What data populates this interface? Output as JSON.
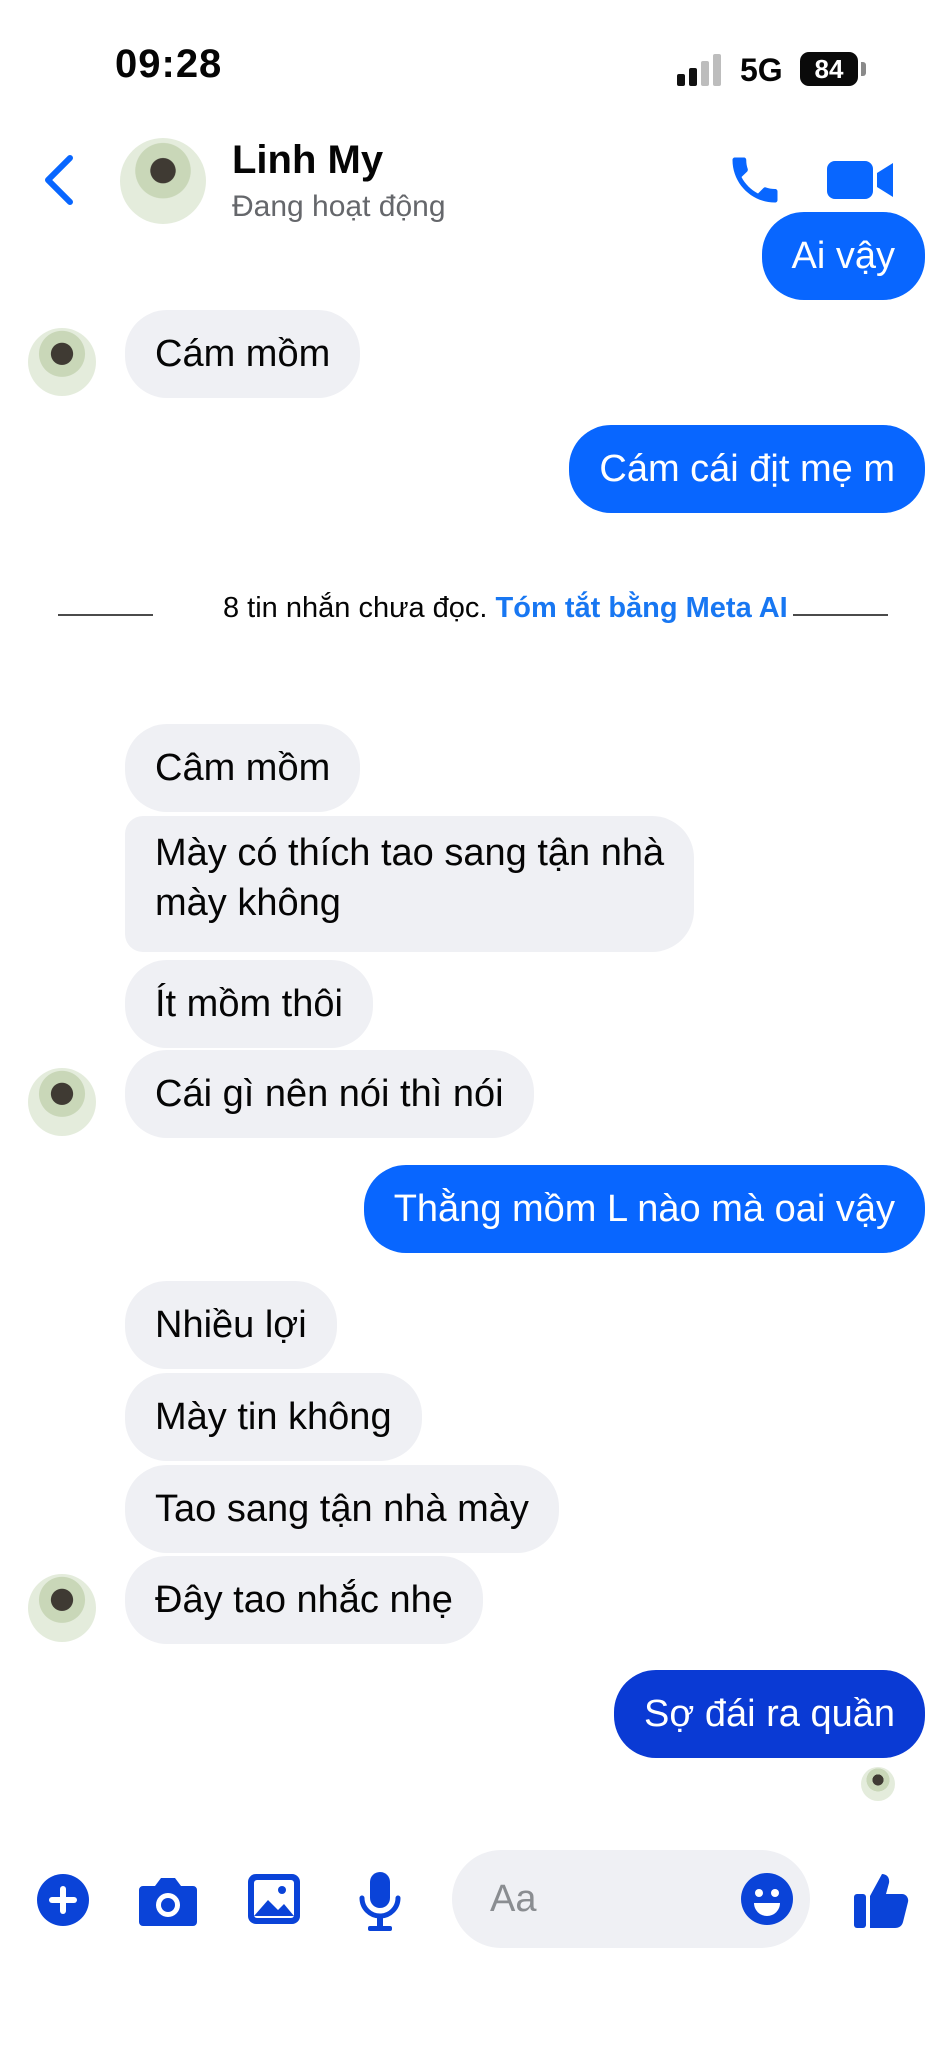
{
  "status_bar": {
    "time": "09:28",
    "network": "5G",
    "battery": "84"
  },
  "header": {
    "name": "Linh My",
    "status": "Đang hoạt động"
  },
  "messages": [
    {
      "dir": "out",
      "text": "Ai vậy"
    },
    {
      "dir": "in",
      "text": "Cám mồm"
    },
    {
      "dir": "out",
      "text": "Cám cái địt mẹ m"
    },
    {
      "dir": "in",
      "text": "Câm mồm"
    },
    {
      "dir": "in",
      "text": "Mày có thích tao sang tận nhà"
    },
    {
      "dir": "in",
      "text": "mày không"
    },
    {
      "dir": "in",
      "text": "Ít mồm thôi"
    },
    {
      "dir": "in",
      "text": "Cái gì nên nói thì nói"
    },
    {
      "dir": "out",
      "text": "Thằng mồm L nào mà oai vậy"
    },
    {
      "dir": "in",
      "text": "Nhiều lợi"
    },
    {
      "dir": "in",
      "text": "Mày tin không"
    },
    {
      "dir": "in",
      "text": "Tao sang tận nhà mày"
    },
    {
      "dir": "in",
      "text": "Đây tao nhắc nhẹ"
    },
    {
      "dir": "out",
      "text": "Sợ đái ra quần"
    }
  ],
  "divider": {
    "text": "8 tin nhắn chưa đọc.",
    "link": "Tóm tắt bằng Meta AI"
  },
  "composer": {
    "placeholder": "Aa"
  },
  "icons": {
    "back": "chevron-left-icon",
    "call": "phone-icon",
    "video": "video-camera-icon",
    "add": "plus-icon",
    "camera": "camera-icon",
    "gallery": "image-icon",
    "mic": "microphone-icon",
    "emoji": "smiley-icon",
    "like": "thumbs-up-icon"
  },
  "colors": {
    "accent": "#0866ff",
    "icon": "#0a43d8",
    "incoming_bubble": "#eff0f4"
  }
}
